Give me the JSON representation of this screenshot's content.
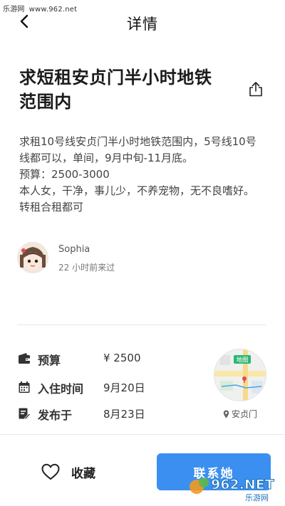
{
  "watermark": {
    "left": "乐游网",
    "url": "www.962.net"
  },
  "header": {
    "title": "详情"
  },
  "post": {
    "title_line1": "求短租安贞门半小时地铁",
    "title_line2": "范围内",
    "description": [
      "求租10号线安贞门半小时地铁范围内，5号线10号",
      "线都可以，单间，9月中旬-11月底。",
      "预算：2500-3000",
      "本人女，干净，事儿少，不养宠物，无不良嗜好。",
      "转租合租都可"
    ]
  },
  "author": {
    "name": "Sophia",
    "last_seen": "22 小时前来过"
  },
  "info": {
    "budget_label": "预算",
    "budget_value": "¥ 2500",
    "checkin_label": "入住时间",
    "checkin_value": "9月20日",
    "posted_label": "发布于",
    "posted_value": "8月23日"
  },
  "map": {
    "badge": "地图",
    "location": "安贞门"
  },
  "actions": {
    "favorite_label": "收藏",
    "contact_label": "联系她"
  },
  "watermark_bottom": {
    "brand": "962.NET",
    "sub": "乐游网"
  },
  "colors": {
    "accent": "#3b8ff0",
    "map_badge": "#2bb673"
  }
}
